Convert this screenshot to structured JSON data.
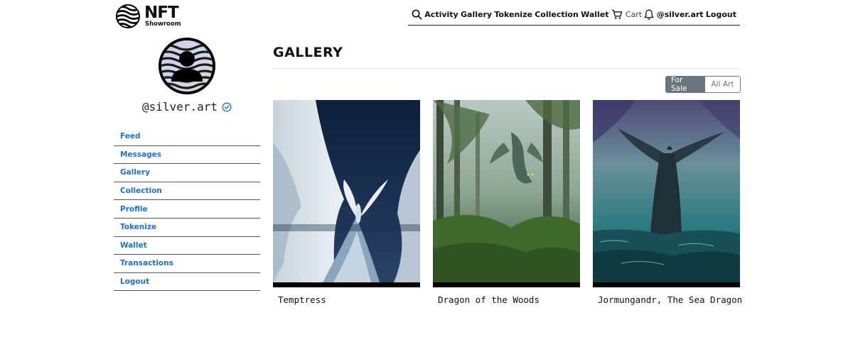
{
  "brand": {
    "name": "NFT",
    "tagline": "Showroom"
  },
  "topnav": {
    "links": [
      "Activity",
      "Gallery",
      "Tokenize",
      "Collection",
      "Wallet"
    ],
    "cart_label": "Cart",
    "user_link": "@silver.art",
    "logout": "Logout"
  },
  "profile": {
    "username": "@silver.art"
  },
  "sidebar": {
    "items": [
      {
        "label": "Feed"
      },
      {
        "label": "Messages"
      },
      {
        "label": "Gallery"
      },
      {
        "label": "Collection"
      },
      {
        "label": "Profile"
      },
      {
        "label": "Tokenize"
      },
      {
        "label": "Wallet"
      },
      {
        "label": "Transactions"
      },
      {
        "label": "Logout"
      }
    ]
  },
  "main": {
    "title": "GALLERY",
    "filter": {
      "active": "For Sale",
      "inactive": "All Art"
    },
    "artworks": [
      {
        "title": "Temptress"
      },
      {
        "title": "Dragon of the Woods"
      },
      {
        "title": "Jormungandr, The Sea Dragon"
      }
    ]
  },
  "colors": {
    "link": "#1a73c8",
    "toggle_active": "#6c757d"
  }
}
